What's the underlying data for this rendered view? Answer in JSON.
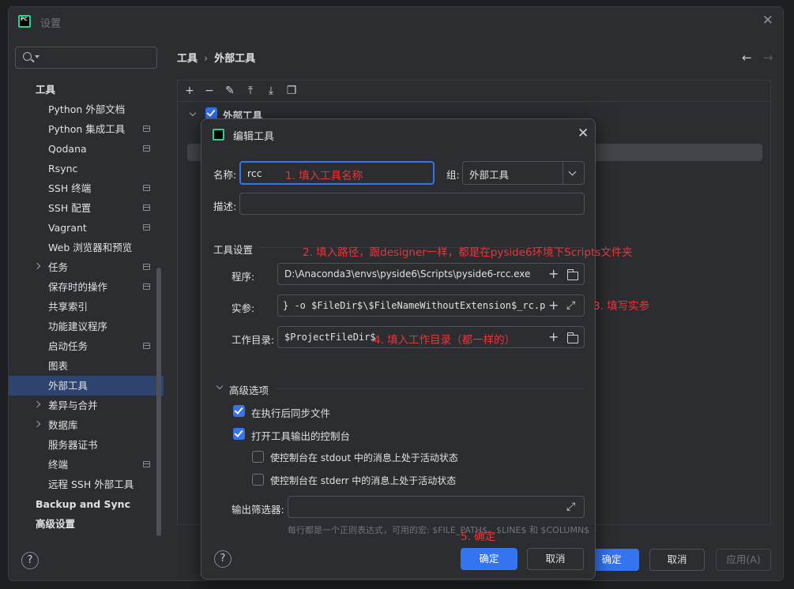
{
  "window": {
    "title": "设置"
  },
  "sidebar": {
    "search_placeholder": "",
    "items": [
      {
        "label": "工具"
      },
      {
        "label": "Python 外部文档"
      },
      {
        "label": "Python 集成工具"
      },
      {
        "label": "Qodana"
      },
      {
        "label": "Rsync"
      },
      {
        "label": "SSH 终端"
      },
      {
        "label": "SSH 配置"
      },
      {
        "label": "Vagrant"
      },
      {
        "label": "Web 浏览器和预览"
      },
      {
        "label": "任务"
      },
      {
        "label": "保存时的操作"
      },
      {
        "label": "共享索引"
      },
      {
        "label": "功能建议程序"
      },
      {
        "label": "启动任务"
      },
      {
        "label": "图表"
      },
      {
        "label": "外部工具"
      },
      {
        "label": "差异与合并"
      },
      {
        "label": "数据库"
      },
      {
        "label": "服务器证书"
      },
      {
        "label": "终端"
      },
      {
        "label": "远程 SSH 外部工具"
      },
      {
        "label": "Backup and Sync"
      },
      {
        "label": "高级设置"
      }
    ]
  },
  "breadcrumb": {
    "parent": "工具",
    "current": "外部工具"
  },
  "content": {
    "group_label": "外部工具"
  },
  "footer": {
    "ok": "确定",
    "cancel": "取消",
    "apply": "应用(A)"
  },
  "dialog": {
    "title": "编辑工具",
    "name_label": "名称:",
    "name_value": "rcc",
    "group_label": "组:",
    "group_value": "外部工具",
    "desc_label": "描述:",
    "desc_value": "",
    "tool_settings_label": "工具设置",
    "program_label": "程序:",
    "program_value": "D:\\Anaconda3\\envs\\pyside6\\Scripts\\pyside6-rcc.exe",
    "args_label": "实参:",
    "args_value": "} -o $FileDir$\\$FileNameWithoutExtension$_rc.py",
    "workdir_label": "工作目录:",
    "workdir_value": "$ProjectFileDir$",
    "advanced_label": "高级选项",
    "sync_files_label": "在执行后同步文件",
    "open_console_label": "打开工具输出的控制台",
    "stdout_label": "使控制台在 stdout 中的消息上处于活动状态",
    "stderr_label": "使控制台在 stderr 中的消息上处于活动状态",
    "filter_label": "输出筛选器:",
    "filter_hint": "每行都是一个正则表达式，可用的宏: $FILE_PATH$、$LINE$ 和 $COLUMN$",
    "ok": "确定",
    "cancel": "取消"
  },
  "annotations": {
    "a1": "1. 填入工具名称",
    "a2": "2. 填入路径，跟designer一样，都是在pyside6环境下Scripts文件夹",
    "a3": "3. 填写实参",
    "a4": "4. 填入工作目录（都一样的）",
    "a5": "5. 确定"
  }
}
